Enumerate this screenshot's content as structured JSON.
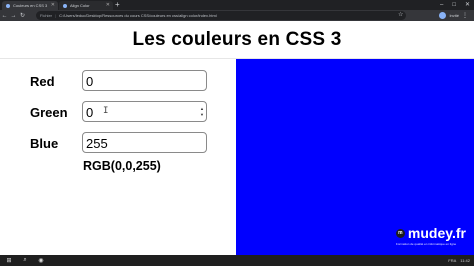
{
  "browser": {
    "tabs": [
      {
        "label": "Couleurs en CSS 3"
      },
      {
        "label": "Align Color"
      }
    ],
    "new_tab_glyph": "+",
    "window_controls": [
      "–",
      "□",
      "✕"
    ],
    "nav": {
      "back": "←",
      "forward": "→",
      "reload": "↻"
    },
    "address": {
      "scheme_label": "Fichier",
      "separator": "|",
      "url": "C:/Users/leduc/Desktop/Ressources du cours CSS/couleurs en css/align color/index.html"
    },
    "profile_name": "Invité",
    "menu_glyph": "⋮",
    "star_glyph": "☆"
  },
  "page": {
    "title": "Les couleurs en CSS 3",
    "fields": [
      {
        "key": "red",
        "label": "Red",
        "value": "0"
      },
      {
        "key": "green",
        "label": "Green",
        "value": "0"
      },
      {
        "key": "blue",
        "label": "Blue",
        "value": "255"
      }
    ],
    "rgb_readout": "RGB(0,0,255)",
    "preview_color": "#0000ff"
  },
  "watermark": {
    "logo_text": "m",
    "name": "mudey.fr",
    "tagline": "Formation de qualité en informatique en ligne"
  },
  "icons": {
    "tab_favicon": "globe-icon",
    "stepper": "spin-arrows-icon",
    "cursor": "text-cursor-icon",
    "start": "windows-logo-icon",
    "search": "search-icon"
  },
  "taskbar": {
    "tray": {
      "lang": "FRA",
      "time": "11:42"
    }
  }
}
